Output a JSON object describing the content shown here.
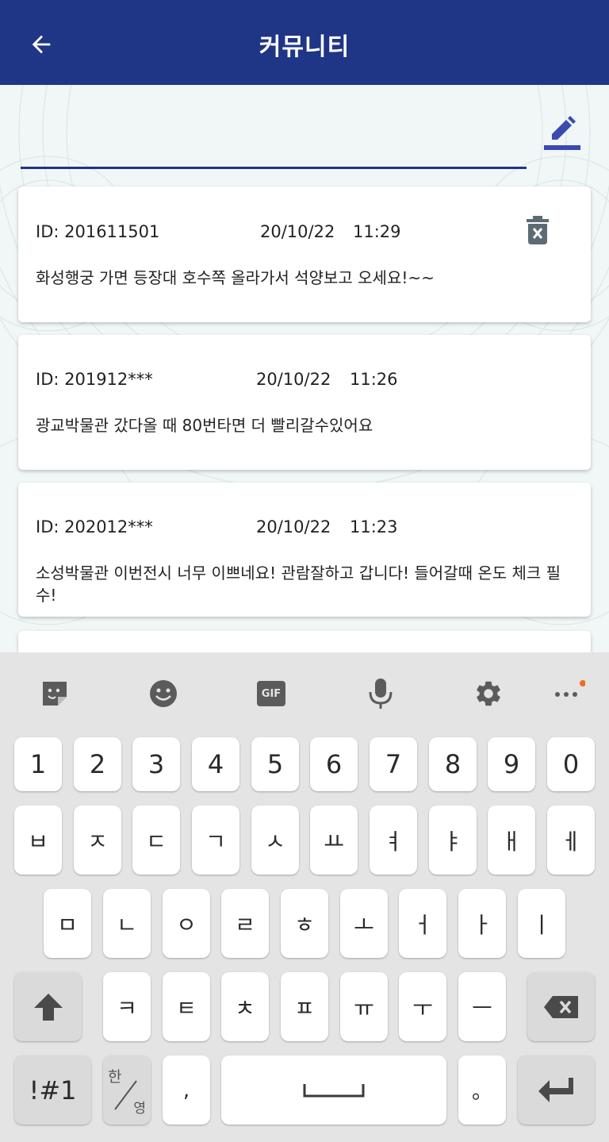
{
  "appbar": {
    "title": "커뮤니티",
    "back_icon": "arrow-left-icon"
  },
  "compose": {
    "input_value": "",
    "write_icon": "pencil-icon"
  },
  "posts": [
    {
      "id": "ID: 201611501",
      "date": "20/10/22",
      "time": "11:29",
      "text": "화성행궁 가면 등장대 호수쪽 올라가서 석양보고 오세요!~~",
      "delete_icon": "trash-icon"
    },
    {
      "id": "ID: 201912***",
      "date": "20/10/22",
      "time": "11:26",
      "text": "광교박물관 갔다올 때 80번타면 더 빨리갈수있어요"
    },
    {
      "id": "ID: 202012***",
      "date": "20/10/22",
      "time": "11:23",
      "text": "소성박물관 이번전시 너무 이쁘네요! 관람잘하고 갑니다! 들어갈때 온도 체크 필수!"
    }
  ],
  "keyboard": {
    "toolbar": [
      "sticker-icon",
      "emoji-icon",
      "gif-icon",
      "microphone-icon",
      "settings-icon",
      "more-icon"
    ],
    "gif_label": "GIF",
    "row_numbers": [
      "1",
      "2",
      "3",
      "4",
      "5",
      "6",
      "7",
      "8",
      "9",
      "0"
    ],
    "row1": [
      "ㅂ",
      "ㅈ",
      "ㄷ",
      "ㄱ",
      "ㅅ",
      "ㅛ",
      "ㅕ",
      "ㅑ",
      "ㅐ",
      "ㅔ"
    ],
    "row2": [
      "ㅁ",
      "ㄴ",
      "ㅇ",
      "ㄹ",
      "ㅎ",
      "ㅗ",
      "ㅓ",
      "ㅏ",
      "ㅣ"
    ],
    "row3": [
      "ㅋ",
      "ㅌ",
      "ㅊ",
      "ㅍ",
      "ㅠ",
      "ㅜ",
      "ㅡ"
    ],
    "symbols_label": "!#1",
    "lang_top": "한",
    "lang_bottom": "영",
    "comma": ",",
    "period": "。"
  },
  "colors": {
    "primary": "#1f3585",
    "delete_icon": "#5c6b73",
    "notification_dot": "#ef6c1f"
  }
}
